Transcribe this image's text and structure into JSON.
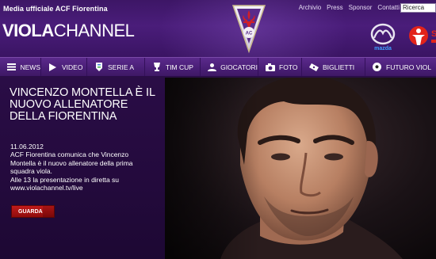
{
  "header": {
    "tagline": "Media ufficiale ACF Fiorentina",
    "logo_bold": "VIOLA",
    "logo_light": "CHANNEL",
    "crest_letters": "AC",
    "toplinks": [
      "Archivio",
      "Press",
      "Sponsor",
      "Contatti"
    ],
    "search_placeholder": "Ricerca",
    "sponsor_mazda": "mazda",
    "sponsor_save_partial": "S"
  },
  "nav": {
    "items": [
      {
        "label": "NEWS",
        "icon": "news-icon"
      },
      {
        "label": "VIDEO",
        "icon": "play-icon"
      },
      {
        "label": "SERIE A",
        "icon": "serie-a-icon"
      },
      {
        "label": "TIM CUP",
        "icon": "cup-icon"
      },
      {
        "label": "GIOCATORI",
        "icon": "players-icon"
      },
      {
        "label": "FOTO",
        "icon": "camera-icon"
      },
      {
        "label": "BIGLIETTI",
        "icon": "ticket-icon"
      },
      {
        "label": "FUTURO VIOL",
        "icon": "ball-icon"
      }
    ]
  },
  "main": {
    "headline": "VINCENZO MONTELLA È IL NUOVO ALLENATORE DELLA FIORENTINA",
    "date": "11.06.2012",
    "body_lines": [
      "ACF Fiorentina comunica che Vincenzo",
      "Montella è il nuovo allenatore della prima",
      "squadra viola.",
      "Alle 13 la presentazione in diretta su",
      "www.violachannel.tv/live"
    ],
    "cta_label": "GUARDA"
  },
  "colors": {
    "header_purple": "#4a1d7a",
    "nav_purple": "#4f2380",
    "panel_purple": "#250b40",
    "cta_red": "#b31616"
  }
}
